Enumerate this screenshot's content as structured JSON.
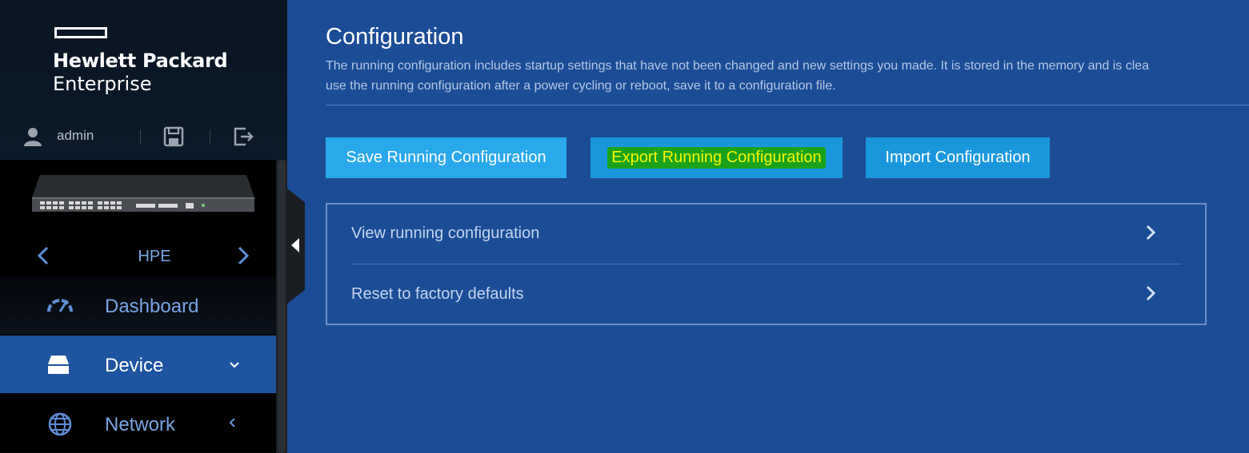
{
  "brand": {
    "line1": "Hewlett Packard",
    "line2": "Enterprise"
  },
  "user": {
    "name": "admin"
  },
  "device": {
    "name": "HPE"
  },
  "nav": {
    "items": [
      {
        "label": "Dashboard",
        "icon": "gauge-icon"
      },
      {
        "label": "Device",
        "icon": "device-icon",
        "caret": "chevron-down-icon",
        "active": true
      },
      {
        "label": "Network",
        "icon": "globe-icon",
        "caret": "chevron-left-icon"
      }
    ]
  },
  "page": {
    "title": "Configuration",
    "description_line1": "The running configuration includes startup settings that have not been changed and new settings you made. It is stored in the memory and is clea",
    "description_line2": "use the running configuration after a power cycling or reboot, save it to a configuration file."
  },
  "actions": {
    "save_label": "Save Running Configuration",
    "export_label": "Export Running Configuration",
    "import_label": "Import Configuration"
  },
  "panel": {
    "rows": [
      {
        "label": "View running configuration"
      },
      {
        "label": "Reset to factory defaults"
      }
    ]
  },
  "colors": {
    "main_bg": "#1c4c96",
    "sidebar_bg": "#06080c",
    "active_nav": "#1f54a0",
    "button_primary": "#29a8ec",
    "button_secondary": "#1a97dc",
    "highlight_bg": "#1aa31a",
    "highlight_text": "#f5f500"
  }
}
